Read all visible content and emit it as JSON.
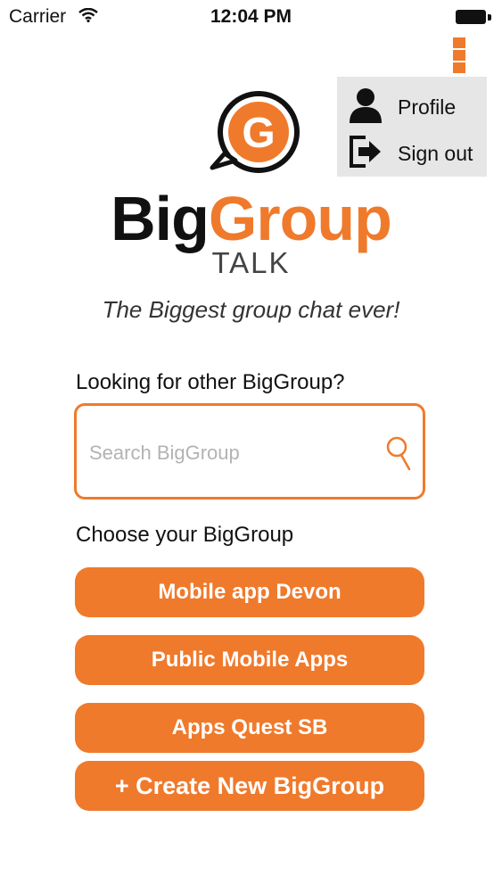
{
  "status_bar": {
    "carrier": "Carrier",
    "time": "12:04 PM"
  },
  "menu": {
    "items": [
      {
        "label": "Profile",
        "icon": "person-icon"
      },
      {
        "label": "Sign out",
        "icon": "sign-out-icon"
      }
    ]
  },
  "logo": {
    "badge_letter": "G",
    "word_big": "Big",
    "word_group": "Group",
    "sub": "TALK"
  },
  "tagline": "The Biggest group chat ever!",
  "search": {
    "heading": "Looking for other BigGroup?",
    "placeholder": "Search BigGroup",
    "value": ""
  },
  "groups": {
    "heading": "Choose your BigGroup",
    "items": [
      {
        "label": "Mobile app Devon"
      },
      {
        "label": "Public Mobile Apps"
      },
      {
        "label": "Apps Quest SB"
      }
    ],
    "create_label": "+ Create New BigGroup"
  },
  "colors": {
    "accent": "#ef7a2c",
    "menu_bg": "#e6e6e6"
  }
}
